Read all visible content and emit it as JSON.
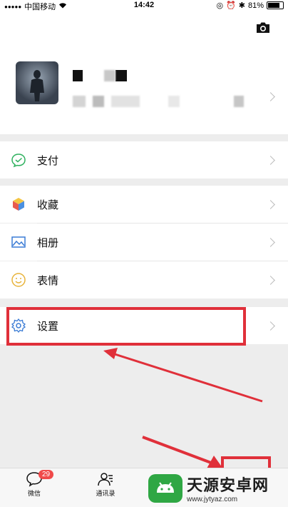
{
  "status_bar": {
    "carrier": "中国移动",
    "time": "14:42",
    "battery": "81%",
    "battery_level": 0.81
  },
  "profile": {
    "camera": "camera-icon",
    "chevron": "chevron-right-icon"
  },
  "menu": {
    "pay": "支付",
    "favorites": "收藏",
    "album": "相册",
    "stickers": "表情",
    "settings": "设置"
  },
  "tabbar": {
    "chats": "微信",
    "chats_badge": "29",
    "contacts": "通讯录"
  },
  "watermark": {
    "title": "天源安卓网",
    "url": "www.jytyaz.com"
  },
  "colors": {
    "highlight": "#e0303a",
    "badge": "#f04a4a",
    "pay_green": "#2fb15e",
    "settings_blue": "#3a7bd5"
  }
}
